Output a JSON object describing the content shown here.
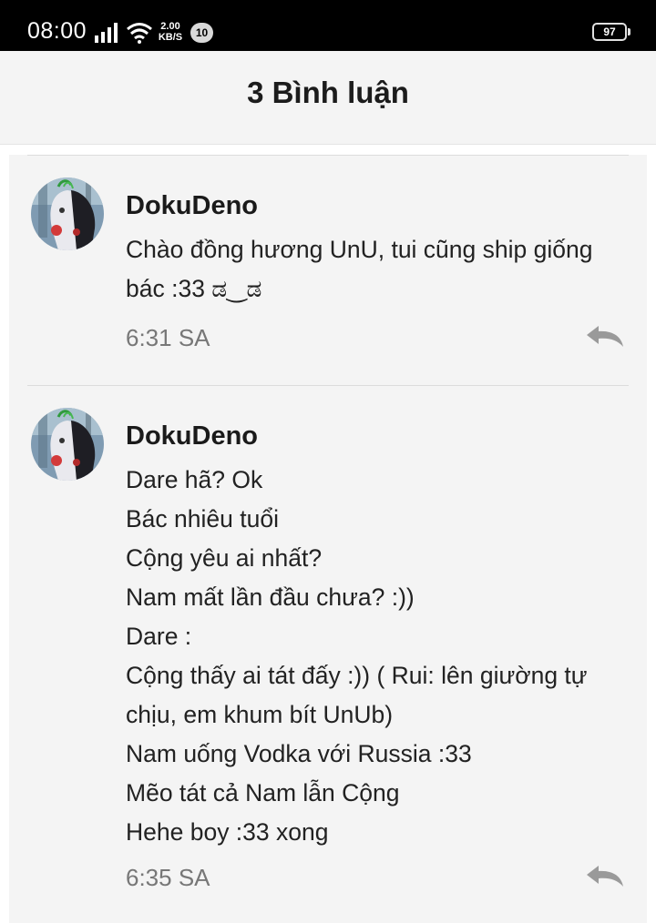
{
  "status_bar": {
    "time": "08:00",
    "net_speed_value": "2.00",
    "net_speed_unit": "KB/S",
    "notification_count": "10",
    "battery": "97"
  },
  "header": {
    "title": "3 Bình luận"
  },
  "comments": [
    {
      "author": "DokuDeno",
      "lines": [
        "Chào đồng hương UnU, tui cũng ship giống",
        "bác :33 ಡ‿ಡ"
      ],
      "time": "6:31 SA"
    },
    {
      "author": "DokuDeno",
      "lines": [
        "Dare hã? Ok",
        "Bác nhiêu tuổi",
        "Cộng yêu ai nhất?",
        "Nam mất lần đầu chưa? :))",
        "Dare :",
        "Cộng thấy ai tát đấy :)) ( Rui: lên giường tự",
        "chịu, em khum bít UnUb)",
        "Nam uống Vodka với Russia :33",
        "Mẽo tát cả Nam lẫn Cộng",
        "Hehe boy :33 xong"
      ],
      "time": "6:35 SA"
    }
  ]
}
